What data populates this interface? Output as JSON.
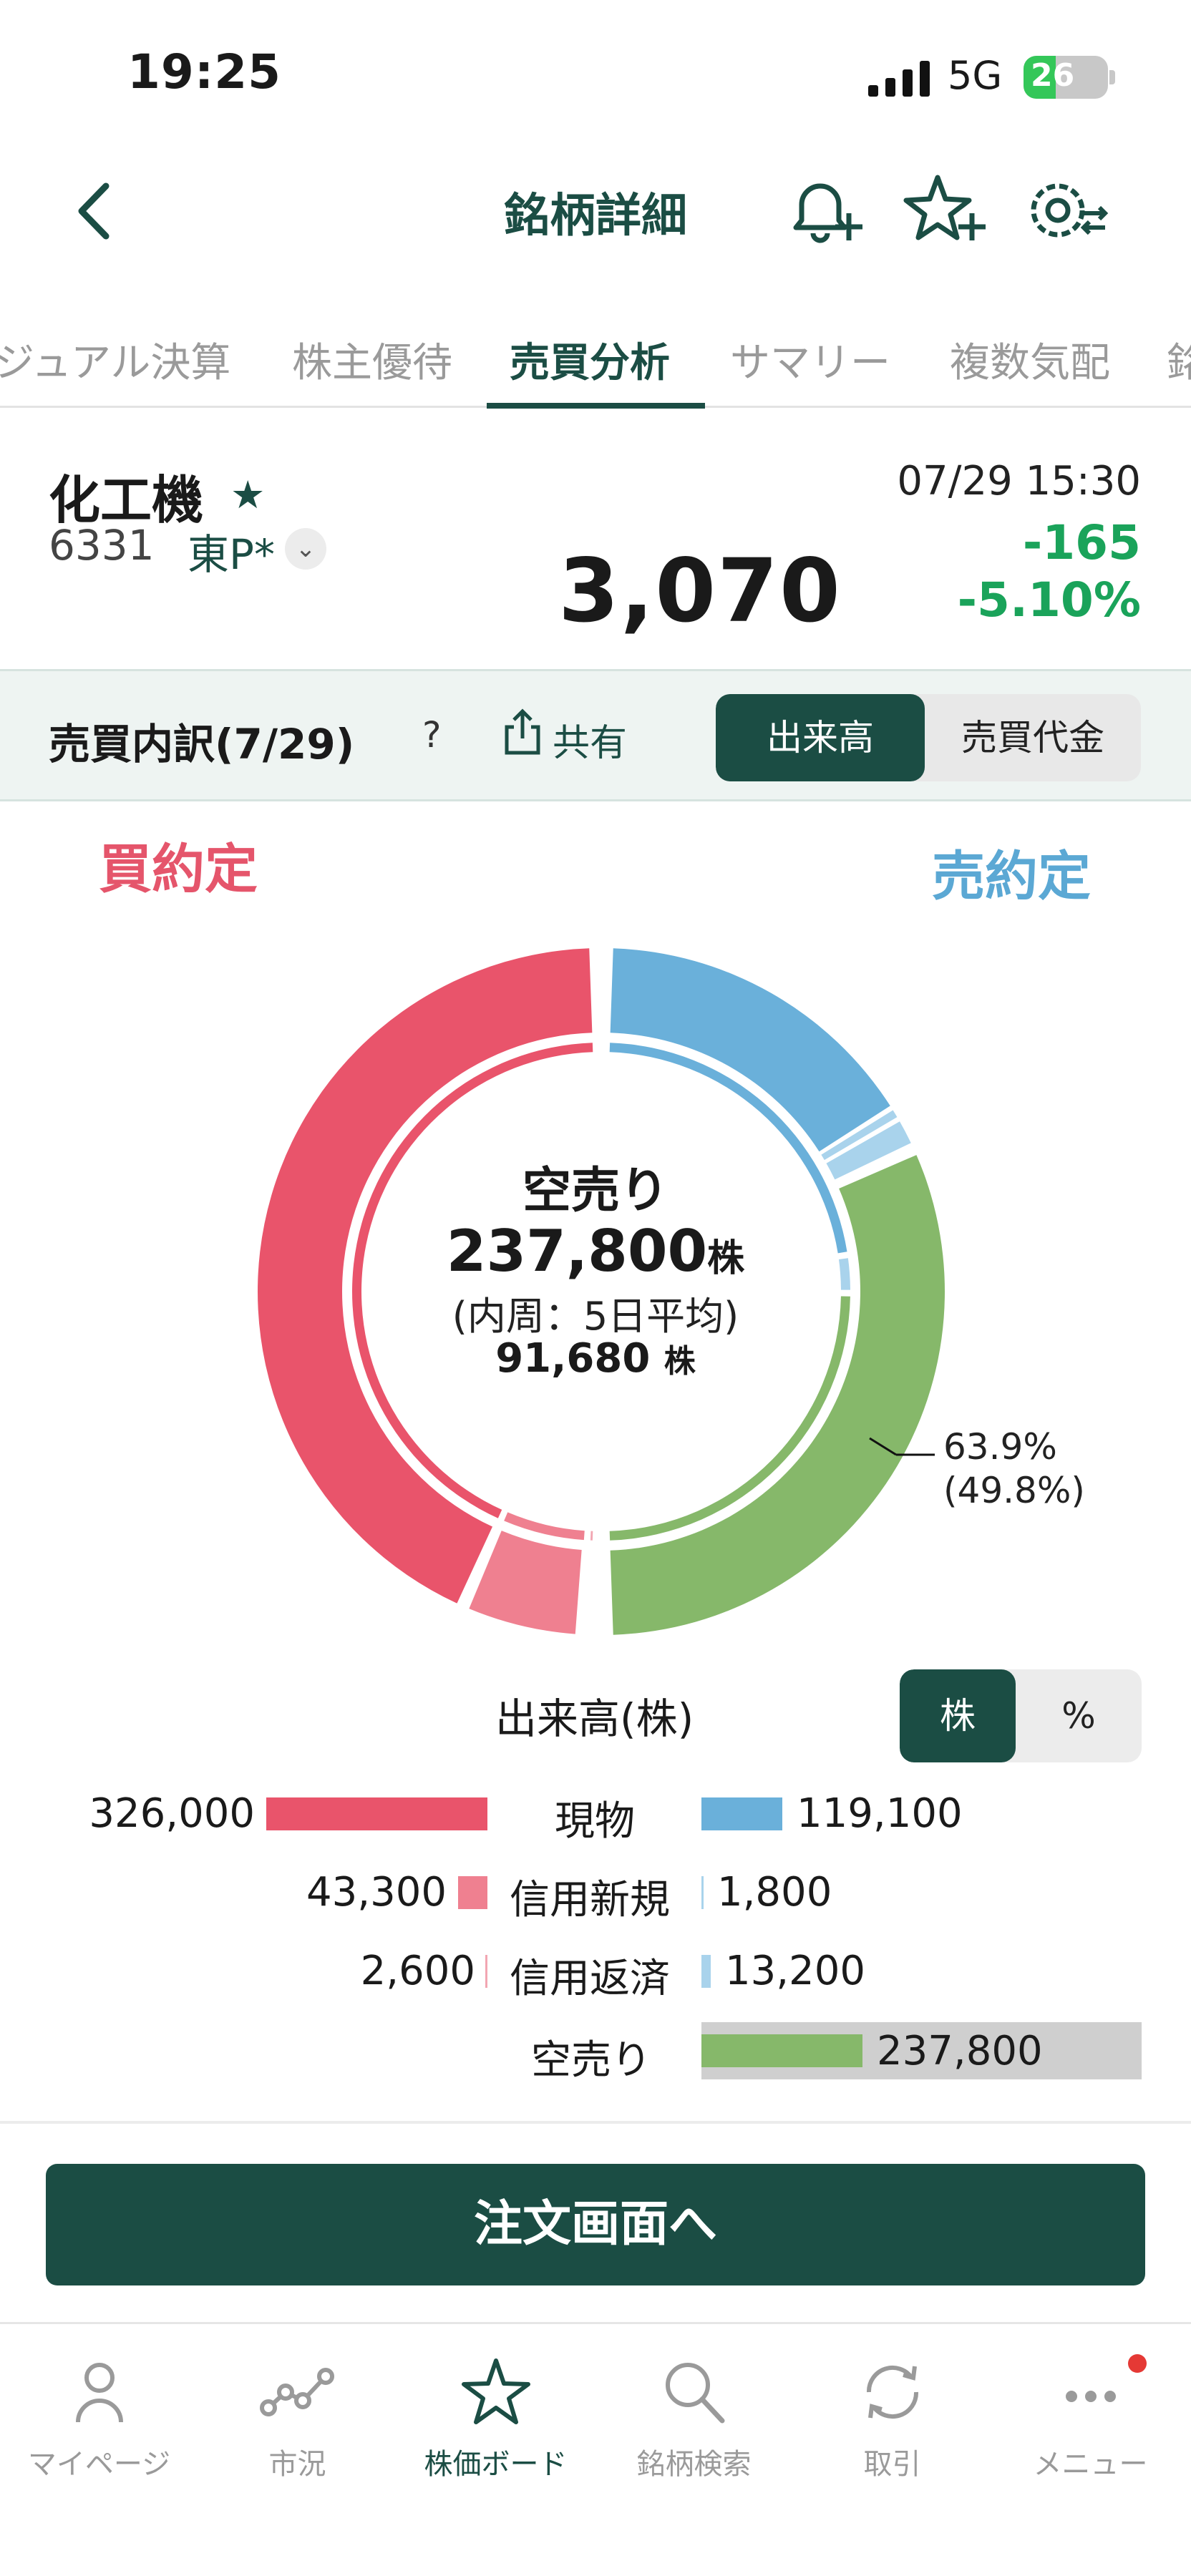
{
  "status_bar": {
    "time": "19:25",
    "network": "5G",
    "battery": "26"
  },
  "header": {
    "title": "銘柄詳細"
  },
  "tabs": [
    {
      "label": "ジュアル決算",
      "active": false
    },
    {
      "label": "株主優待",
      "active": false
    },
    {
      "label": "売買分析",
      "active": true
    },
    {
      "label": "サマリー",
      "active": false
    },
    {
      "label": "複数気配",
      "active": false
    },
    {
      "label": "銘",
      "active": false
    }
  ],
  "stock": {
    "name": "化工機",
    "code": "6331",
    "market": "東P*",
    "timestamp": "07/29 15:30",
    "price": "3,070",
    "change": "-165",
    "change_pct": "-5.10%"
  },
  "breakdown": {
    "title": "売買内訳(7/29)",
    "help": "?",
    "share_label": "共有",
    "toggle": {
      "volume": "出来高",
      "value": "売買代金",
      "selected": "volume"
    }
  },
  "chart_headers": {
    "buy": "買約定",
    "sell": "売約定"
  },
  "donut": {
    "center_label": "空売り",
    "center_value": "237,800",
    "center_unit": "株",
    "center_sub": "(内周：5日平均)",
    "center_avg": "91,680",
    "center_avg_unit": "株",
    "pct_label": "63.9%",
    "pct_avg_label": "(49.8%)"
  },
  "chart_data": {
    "type": "donut",
    "unit": "株",
    "outer": {
      "buy": [
        {
          "category": "現物",
          "value": 326000,
          "color": "#e9546b"
        },
        {
          "category": "信用新規",
          "value": 43300,
          "color": "#ef8090"
        },
        {
          "category": "信用返済",
          "value": 2600,
          "color": "#f2a6b2"
        }
      ],
      "sell": [
        {
          "category": "現物",
          "value": 119100,
          "color": "#6ab0da"
        },
        {
          "category": "信用新規",
          "value": 1800,
          "color": "#a9d3ec"
        },
        {
          "category": "信用返済",
          "value": 13200,
          "color": "#a9d3ec"
        },
        {
          "category": "空売り",
          "value": 237800,
          "color": "#86b86a",
          "share_pct": 63.9
        }
      ]
    },
    "inner_5day_avg": {
      "short_value": 91680,
      "short_share_pct": 49.8
    }
  },
  "volume_table": {
    "title": "出来高(株)",
    "unit_toggle": {
      "shares": "株",
      "percent": "%",
      "selected": "shares"
    },
    "rows": [
      {
        "category": "現物",
        "buy": "326,000",
        "sell": "119,100"
      },
      {
        "category": "信用新規",
        "buy": "43,300",
        "sell": "1,800"
      },
      {
        "category": "信用返済",
        "buy": "2,600",
        "sell": "13,200"
      }
    ],
    "short": {
      "category": "空売り",
      "value": "237,800"
    }
  },
  "order_button": {
    "label": "注文画面へ"
  },
  "bottom_nav": [
    {
      "label": "マイページ",
      "icon": "person-icon"
    },
    {
      "label": "市況",
      "icon": "market-chart-icon"
    },
    {
      "label": "株価ボード",
      "icon": "star-icon",
      "active": true
    },
    {
      "label": "銘柄検索",
      "icon": "search-icon"
    },
    {
      "label": "取引",
      "icon": "sync-icon"
    },
    {
      "label": "メニュー",
      "icon": "more-icon"
    }
  ]
}
